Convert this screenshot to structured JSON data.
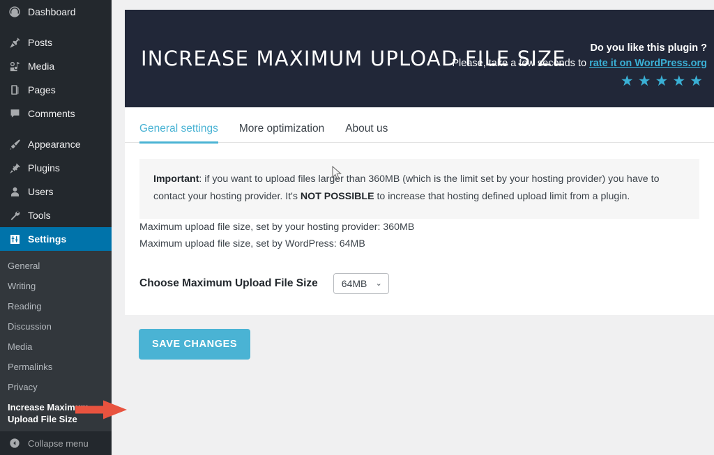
{
  "sidebar": {
    "items": [
      {
        "label": "Dashboard",
        "icon": "dashboard-icon",
        "current": false
      },
      {
        "label": "Posts",
        "icon": "pin-icon",
        "current": false
      },
      {
        "label": "Media",
        "icon": "media-icon",
        "current": false
      },
      {
        "label": "Pages",
        "icon": "page-icon",
        "current": false
      },
      {
        "label": "Comments",
        "icon": "comment-icon",
        "current": false
      },
      {
        "label": "Appearance",
        "icon": "brush-icon",
        "current": false
      },
      {
        "label": "Plugins",
        "icon": "plug-icon",
        "current": false
      },
      {
        "label": "Users",
        "icon": "user-icon",
        "current": false
      },
      {
        "label": "Tools",
        "icon": "wrench-icon",
        "current": false
      },
      {
        "label": "Settings",
        "icon": "settings-sliders-icon",
        "current": true
      }
    ],
    "submenu": [
      {
        "label": "General",
        "current": false
      },
      {
        "label": "Writing",
        "current": false
      },
      {
        "label": "Reading",
        "current": false
      },
      {
        "label": "Discussion",
        "current": false
      },
      {
        "label": "Media",
        "current": false
      },
      {
        "label": "Permalinks",
        "current": false
      },
      {
        "label": "Privacy",
        "current": false
      },
      {
        "label": "Increase Maximum Upload File Size",
        "current": true
      }
    ],
    "collapse_label": "Collapse menu",
    "collapse_icon": "chevron-left-circle-icon",
    "bg_color": "#23282d",
    "submenu_bg_color": "#32373c",
    "active_color": "#0073aa"
  },
  "banner": {
    "title": "INCREASE MAXIMUM UPLOAD FILE SIZE",
    "question": "Do you like this plugin ?",
    "ask_prefix": "Please, take a few seconds to ",
    "link_text": "rate it on WordPress.org",
    "stars": 5,
    "star_glyph": "★",
    "bg_color": "#212738",
    "accent_color": "#3ab0d5"
  },
  "tabs": [
    {
      "label": "General settings",
      "active": true
    },
    {
      "label": "More optimization",
      "active": false
    },
    {
      "label": "About us",
      "active": false
    }
  ],
  "notice": {
    "strong_label": "Important",
    "part1": ": if you want to upload files larger than 360MB (which is the limit set by your hosting provider) you have to contact your hosting provider. It's ",
    "strong_inline": "NOT POSSIBLE",
    "part2": " to increase that hosting defined upload limit from a plugin."
  },
  "info": {
    "host_limit_line": "Maximum upload file size, set by your hosting provider: 360MB",
    "wp_limit_line": "Maximum upload file size, set by WordPress: 64MB"
  },
  "choose": {
    "label": "Choose Maximum Upload File Size",
    "selected": "64MB",
    "chevron": "⌄",
    "options": [
      "64MB"
    ]
  },
  "save": {
    "label": "SAVE CHANGES",
    "color": "#4ab3d4"
  },
  "annotations": {
    "arrow_color": "#e8533f",
    "cursor": "mouse-pointer"
  }
}
